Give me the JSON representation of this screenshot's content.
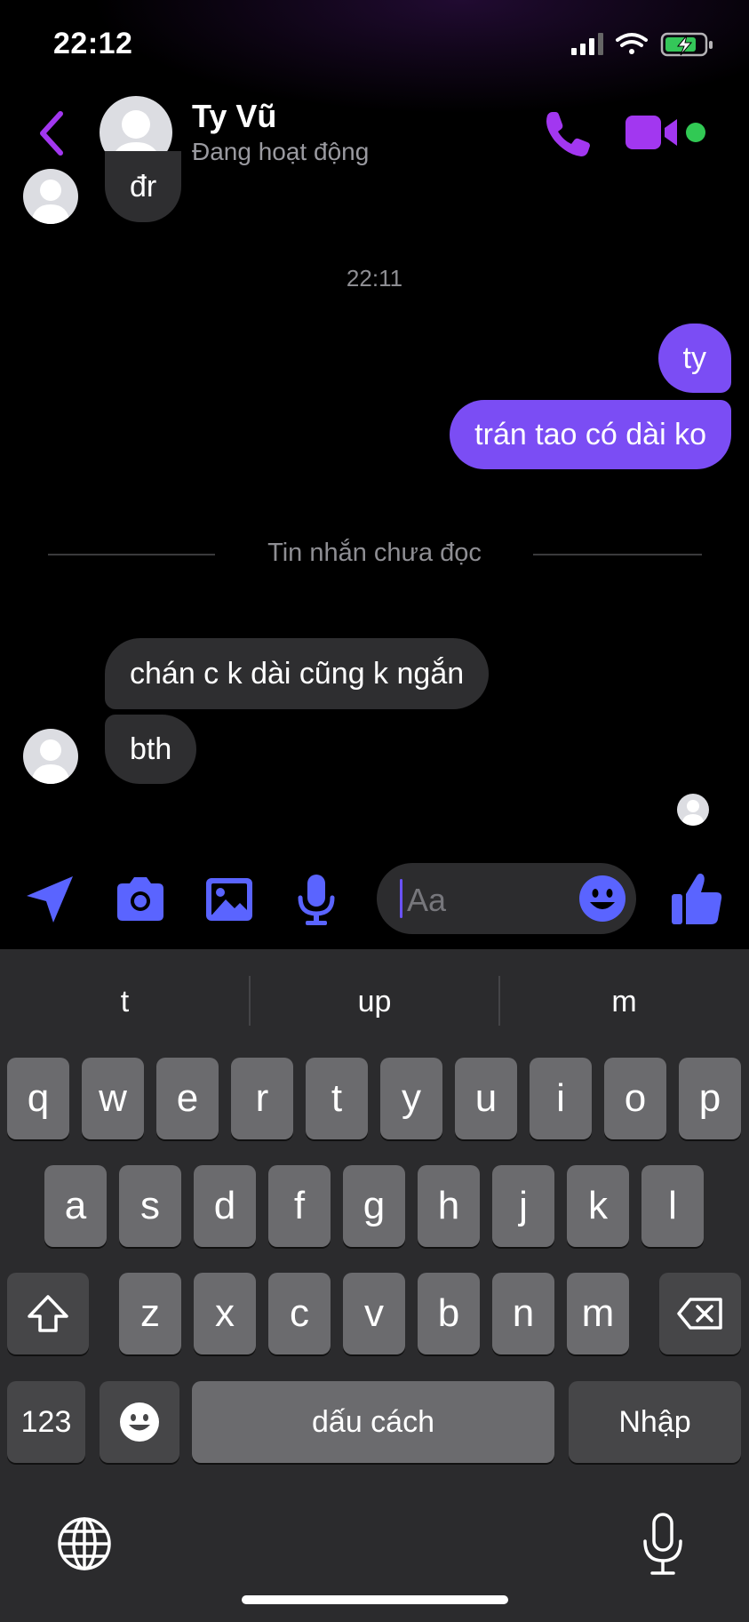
{
  "status_bar": {
    "time": "22:12"
  },
  "header": {
    "contact_name": "Ty Vũ",
    "contact_status": "Đang hoạt động",
    "icons": [
      "back-chevron-icon",
      "phone-icon",
      "video-camera-icon"
    ],
    "accent_color": "#a237f0"
  },
  "chat": {
    "partial_message": "đr",
    "timestamp": "22:11",
    "outgoing": [
      "ty",
      "trán tao có dài ko"
    ],
    "unread_divider": "Tin nhắn chưa đọc",
    "incoming": [
      "chán c k dài cũng k ngắn",
      "bth"
    ],
    "outgoing_color": "#7b4df4",
    "incoming_color": "#2e2e30"
  },
  "composer": {
    "placeholder": "Aa",
    "icons": [
      "send-location-icon",
      "camera-icon",
      "image-icon",
      "microphone-icon",
      "emoji-icon",
      "like-icon"
    ],
    "accent_color": "#5a64ff"
  },
  "keyboard": {
    "suggestions": [
      "t",
      "up",
      "m"
    ],
    "row1": [
      "q",
      "w",
      "e",
      "r",
      "t",
      "y",
      "u",
      "i",
      "o",
      "p"
    ],
    "row2": [
      "a",
      "s",
      "d",
      "f",
      "g",
      "h",
      "j",
      "k",
      "l"
    ],
    "row3": [
      "z",
      "x",
      "c",
      "v",
      "b",
      "n",
      "m"
    ],
    "numbers_label": "123",
    "space_label": "dấu cách",
    "return_label": "Nhập"
  }
}
